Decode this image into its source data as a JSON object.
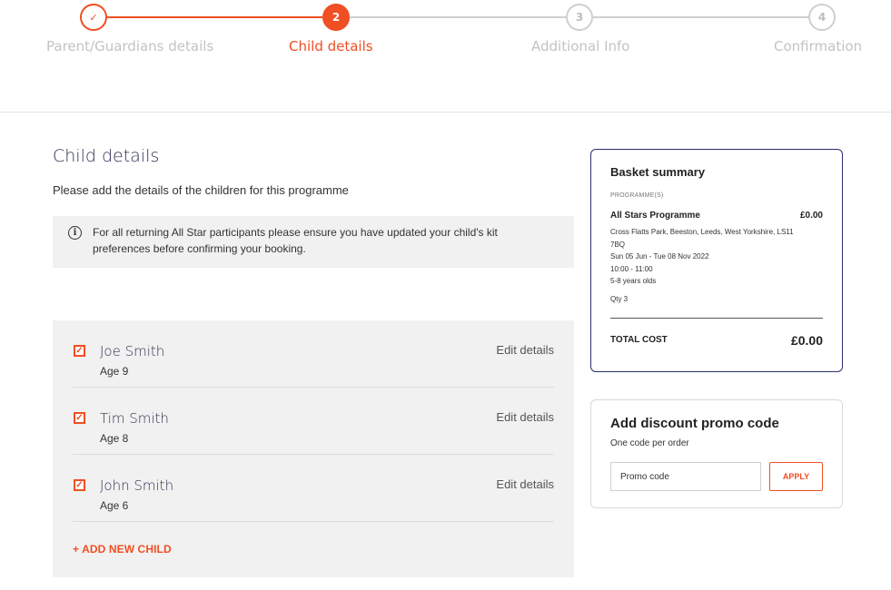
{
  "stepper": {
    "steps": [
      {
        "number": "✓",
        "label": "Parent/Guardians details"
      },
      {
        "number": "2",
        "label": "Child details"
      },
      {
        "number": "3",
        "label": "Additional Info"
      },
      {
        "number": "4",
        "label": "Confirmation"
      }
    ],
    "colors": {
      "active": "#f04e23",
      "inactive": "#cfcfcf"
    }
  },
  "main": {
    "title": "Child details",
    "subtitle": "Please add the details of the children for this programme",
    "info_icon": "info-icon",
    "info_text": "For all returning All Star participants please ensure you have updated your child's kit preferences before confirming your booking.",
    "children": [
      {
        "name": "Joe Smith",
        "age": "Age 9",
        "edit": "Edit details",
        "checked": true
      },
      {
        "name": "Tim Smith",
        "age": "Age 8",
        "edit": "Edit details",
        "checked": true
      },
      {
        "name": "John Smith",
        "age": "Age 6",
        "edit": "Edit details",
        "checked": true
      }
    ],
    "add_child": "+ ADD NEW CHILD"
  },
  "basket": {
    "title": "Basket summary",
    "caption": "PROGRAMME(S)",
    "programme_name": "All Stars Programme",
    "programme_price": "£0.00",
    "address_line1": "Cross Flatts Park, Beeston, Leeds, West Yorkshire, LS11",
    "address_line2": "7BQ",
    "dates": "Sun 05 Jun - Tue 08 Nov 2022",
    "time": "10:00 - 11:00",
    "ages": "5-8 years olds",
    "qty": "Qty 3",
    "total_label": "TOTAL COST",
    "total_value": "£0.00"
  },
  "promo": {
    "title": "Add discount promo code",
    "subtitle": "One code per order",
    "placeholder": "Promo code",
    "apply_label": "APPLY"
  }
}
